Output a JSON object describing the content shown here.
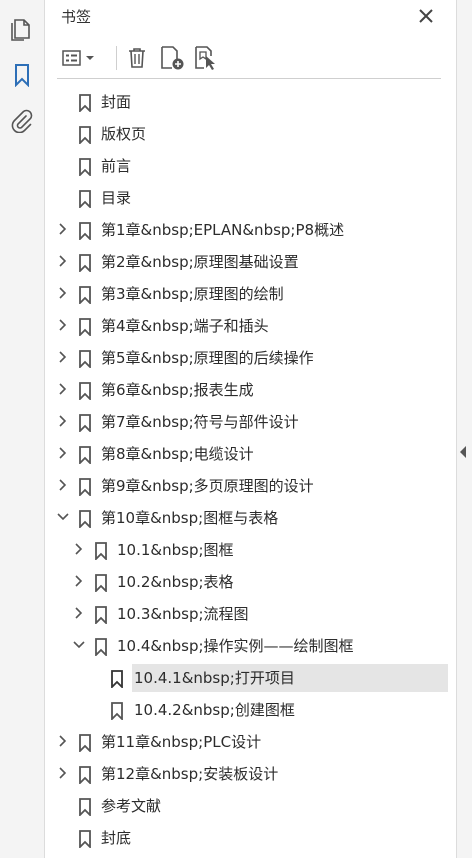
{
  "panel": {
    "title": "书签",
    "close_icon": "close-icon"
  },
  "sidebar": {
    "buttons": [
      "pages-icon",
      "bookmarks-icon",
      "attachments-icon"
    ]
  },
  "toolbar": {
    "icons": [
      "options-menu-icon",
      "delete-bookmark-icon",
      "new-bookmark-icon",
      "new-bookmark-from-structure-icon"
    ]
  },
  "bookmarks": [
    {
      "label": "封面",
      "level": 0,
      "expander": "none"
    },
    {
      "label": "版权页",
      "level": 0,
      "expander": "none"
    },
    {
      "label": "前言",
      "level": 0,
      "expander": "none"
    },
    {
      "label": "目录",
      "level": 0,
      "expander": "none"
    },
    {
      "label": "第1章&nbsp;EPLAN&nbsp;P8概述",
      "level": 0,
      "expander": "collapsed"
    },
    {
      "label": "第2章&nbsp;原理图基础设置",
      "level": 0,
      "expander": "collapsed"
    },
    {
      "label": "第3章&nbsp;原理图的绘制",
      "level": 0,
      "expander": "collapsed"
    },
    {
      "label": "第4章&nbsp;端子和插头",
      "level": 0,
      "expander": "collapsed"
    },
    {
      "label": "第5章&nbsp;原理图的后续操作",
      "level": 0,
      "expander": "collapsed"
    },
    {
      "label": "第6章&nbsp;报表生成",
      "level": 0,
      "expander": "collapsed"
    },
    {
      "label": "第7章&nbsp;符号与部件设计",
      "level": 0,
      "expander": "collapsed"
    },
    {
      "label": "第8章&nbsp;电缆设计",
      "level": 0,
      "expander": "collapsed"
    },
    {
      "label": "第9章&nbsp;多页原理图的设计",
      "level": 0,
      "expander": "collapsed"
    },
    {
      "label": "第10章&nbsp;图框与表格",
      "level": 0,
      "expander": "expanded"
    },
    {
      "label": "10.1&nbsp;图框",
      "level": 1,
      "expander": "collapsed"
    },
    {
      "label": "10.2&nbsp;表格",
      "level": 1,
      "expander": "collapsed"
    },
    {
      "label": "10.3&nbsp;流程图",
      "level": 1,
      "expander": "collapsed"
    },
    {
      "label": "10.4&nbsp;操作实例——绘制图框",
      "level": 1,
      "expander": "expanded"
    },
    {
      "label": "10.4.1&nbsp;打开项目",
      "level": 2,
      "expander": "none",
      "selected": true
    },
    {
      "label": "10.4.2&nbsp;创建图框",
      "level": 2,
      "expander": "none"
    },
    {
      "label": "第11章&nbsp;PLC设计",
      "level": 0,
      "expander": "collapsed"
    },
    {
      "label": "第12章&nbsp;安装板设计",
      "level": 0,
      "expander": "collapsed"
    },
    {
      "label": "参考文献",
      "level": 0,
      "expander": "none"
    },
    {
      "label": "封底",
      "level": 0,
      "expander": "none"
    }
  ],
  "colors": {
    "accent": "#2d6fb7",
    "icon": "#555555",
    "selected_bg": "#e5e5e5"
  }
}
